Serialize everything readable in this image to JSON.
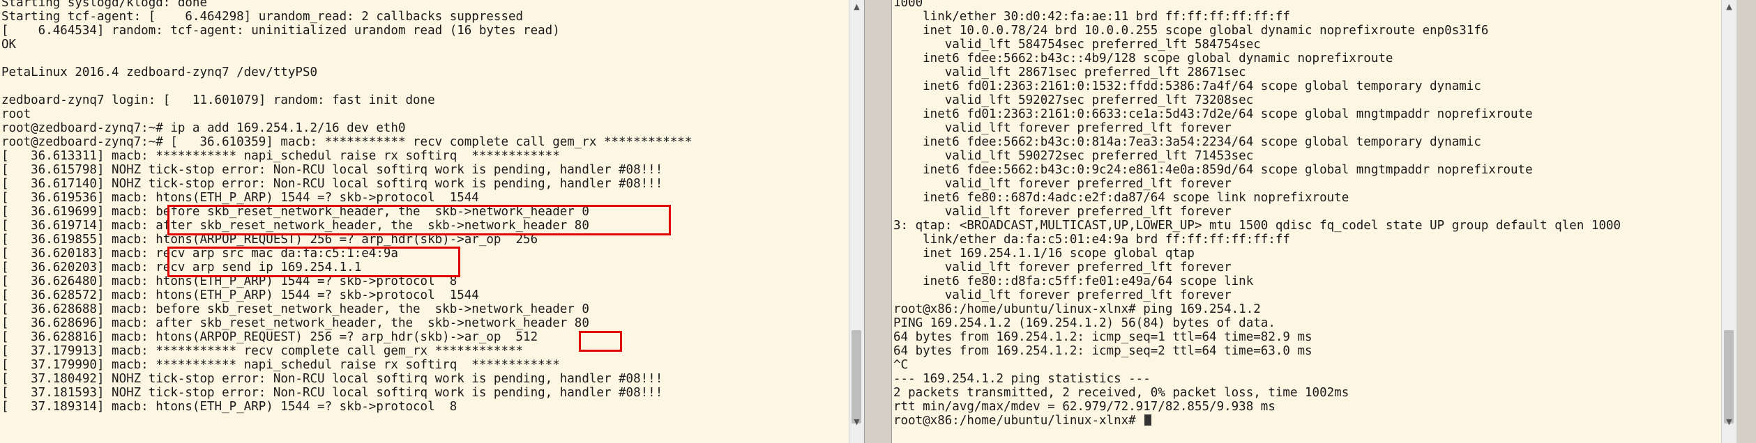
{
  "left_terminal": {
    "lines": [
      "Starting syslogd/klogd: done",
      "Starting tcf-agent: [    6.464298] urandom_read: 2 callbacks suppressed",
      "[    6.464534] random: tcf-agent: uninitialized urandom read (16 bytes read)",
      "OK",
      "",
      "PetaLinux 2016.4 zedboard-zynq7 /dev/ttyPS0",
      "",
      "zedboard-zynq7 login: [   11.601079] random: fast init done",
      "root",
      "root@zedboard-zynq7:~# ip a add 169.254.1.2/16 dev eth0",
      "root@zedboard-zynq7:~# [   36.610359] macb: *********** recv complete call gem_rx ************",
      "[   36.613311] macb: *********** napi_schedul raise rx softirq  ************",
      "[   36.615798] NOHZ tick-stop error: Non-RCU local softirq work is pending, handler #08!!!",
      "[   36.617140] NOHZ tick-stop error: Non-RCU local softirq work is pending, handler #08!!!",
      "[   36.619536] macb: htons(ETH_P_ARP) 1544 =? skb->protocol  1544",
      "[   36.619699] macb: before skb_reset_network_header, the  skb->network_header 0",
      "[   36.619714] macb: after skb_reset_network_header, the  skb->network_header 80",
      "[   36.619855] macb: htons(ARPOP_REQUEST) 256 =? arp_hdr(skb)->ar_op  256",
      "[   36.620183] macb: recv arp src mac da:fa:c5:1:e4:9a",
      "[   36.620203] macb: recv arp send ip 169.254.1.1",
      "[   36.626480] macb: htons(ETH_P_ARP) 1544 =? skb->protocol  8",
      "[   36.628572] macb: htons(ETH_P_ARP) 1544 =? skb->protocol  1544",
      "[   36.628688] macb: before skb_reset_network_header, the  skb->network_header 0",
      "[   36.628696] macb: after skb_reset_network_header, the  skb->network_header 80",
      "[   36.628816] macb: htons(ARPOP_REQUEST) 256 =? arp_hdr(skb)->ar_op  512",
      "[   37.179913] macb: *********** recv complete call gem_rx ************",
      "[   37.179990] macb: *********** napi_schedul raise rx softirq  ************",
      "[   37.180492] NOHZ tick-stop error: Non-RCU local softirq work is pending, handler #08!!!",
      "[   37.181593] NOHZ tick-stop error: Non-RCU local softirq work is pending, handler #08!!!",
      "[   37.189314] macb: htons(ETH_P_ARP) 1544 =? skb->protocol  8",
      ""
    ]
  },
  "right_terminal": {
    "lines": [
      "1000",
      "    link/ether 30:d0:42:fa:ae:11 brd ff:ff:ff:ff:ff:ff",
      "    inet 10.0.0.78/24 brd 10.0.0.255 scope global dynamic noprefixroute enp0s31f6",
      "       valid_lft 584754sec preferred_lft 584754sec",
      "    inet6 fdee:5662:b43c::4b9/128 scope global dynamic noprefixroute",
      "       valid_lft 28671sec preferred_lft 28671sec",
      "    inet6 fd01:2363:2161:0:1532:ffdd:5386:7a4f/64 scope global temporary dynamic",
      "       valid_lft 592027sec preferred_lft 73208sec",
      "    inet6 fd01:2363:2161:0:6633:ce1a:5d43:7d2e/64 scope global mngtmpaddr noprefixroute",
      "       valid_lft forever preferred_lft forever",
      "    inet6 fdee:5662:b43c:0:814a:7ea3:3a54:2234/64 scope global temporary dynamic",
      "       valid_lft 590272sec preferred_lft 71453sec",
      "    inet6 fdee:5662:b43c:0:9c24:e861:4e0a:859d/64 scope global mngtmpaddr noprefixroute",
      "       valid_lft forever preferred_lft forever",
      "    inet6 fe80::687d:4adc:e2f:da87/64 scope link noprefixroute",
      "       valid_lft forever preferred_lft forever",
      "3: qtap: <BROADCAST,MULTICAST,UP,LOWER_UP> mtu 1500 qdisc fq_codel state UP group default qlen 1000",
      "    link/ether da:fa:c5:01:e4:9a brd ff:ff:ff:ff:ff:ff",
      "    inet 169.254.1.1/16 scope global qtap",
      "       valid_lft forever preferred_lft forever",
      "    inet6 fe80::d8fa:c5ff:fe01:e49a/64 scope link",
      "       valid_lft forever preferred_lft forever",
      "root@x86:/home/ubuntu/linux-xlnx# ping 169.254.1.2",
      "PING 169.254.1.2 (169.254.1.2) 56(84) bytes of data.",
      "64 bytes from 169.254.1.2: icmp_seq=1 ttl=64 time=82.9 ms",
      "64 bytes from 169.254.1.2: icmp_seq=2 ttl=64 time=63.0 ms",
      "^C",
      "--- 169.254.1.2 ping statistics ---",
      "2 packets transmitted, 2 received, 0% packet loss, time 1002ms",
      "rtt min/avg/max/mdev = 62.979/72.917/82.855/9.938 ms",
      "root@x86:/home/ubuntu/linux-xlnx# "
    ]
  },
  "colors": {
    "terminal_bg": "#fdf6e3",
    "terminal_fg": "#1b1b1b",
    "highlight_box": "#e00000"
  },
  "icons": {
    "scroll_up": "up-arrow-icon",
    "scroll_down": "down-arrow-icon"
  }
}
